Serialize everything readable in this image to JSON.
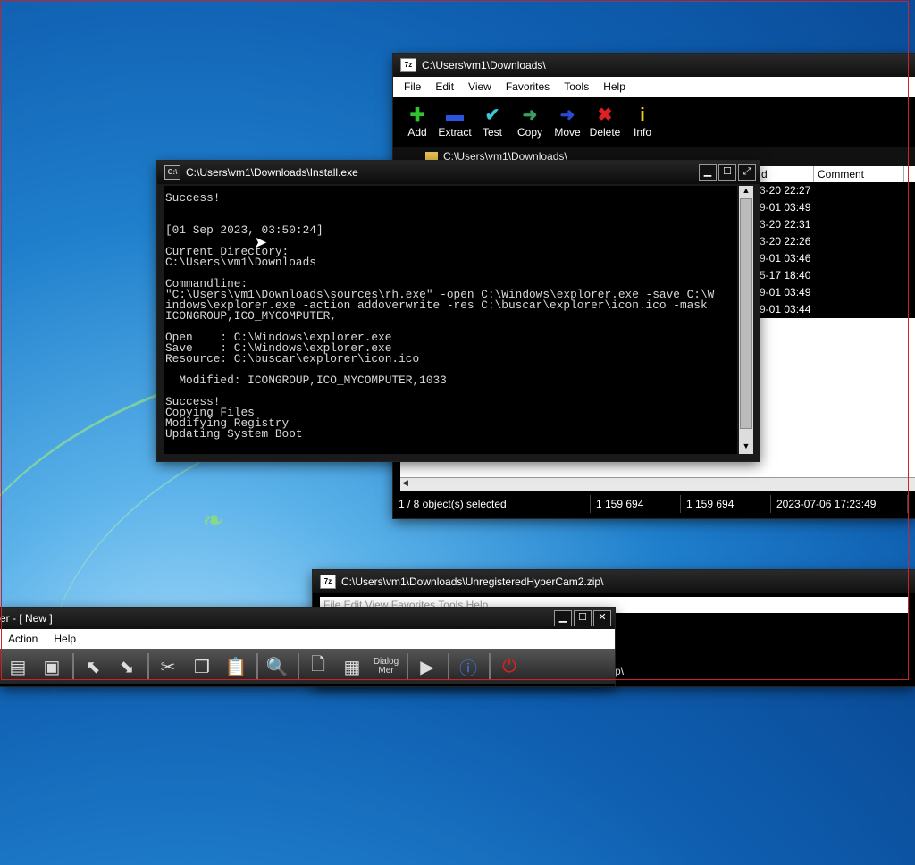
{
  "sevenzip": {
    "title": "C:\\Users\\vm1\\Downloads\\",
    "menu": [
      "File",
      "Edit",
      "View",
      "Favorites",
      "Tools",
      "Help"
    ],
    "toolbar": [
      {
        "label": "Add",
        "icon": "add-icon",
        "glyph": "✚",
        "color": "#2fc42f"
      },
      {
        "label": "Extract",
        "icon": "extract-icon",
        "glyph": "▬",
        "color": "#2a55e0"
      },
      {
        "label": "Test",
        "icon": "test-icon",
        "glyph": "✔",
        "color": "#3cc8d8"
      },
      {
        "label": "Copy",
        "icon": "copy-icon",
        "glyph": "➜",
        "color": "#3aa060"
      },
      {
        "label": "Move",
        "icon": "move-icon",
        "glyph": "➜",
        "color": "#2a4ad0"
      },
      {
        "label": "Delete",
        "icon": "delete-icon",
        "glyph": "✖",
        "color": "#e02020"
      },
      {
        "label": "Info",
        "icon": "info-icon",
        "glyph": "i",
        "color": "#e8d020"
      }
    ],
    "address": "C:\\Users\\vm1\\Downloads\\",
    "columns": [
      "d",
      "Comment"
    ],
    "rows": [
      "3-20 22:27",
      "9-01 03:49",
      "3-20 22:31",
      "3-20 22:26",
      "9-01 03:46",
      "5-17 18:40",
      "9-01 03:49",
      "9-01 03:44"
    ],
    "status": {
      "selection": "1 / 8 object(s) selected",
      "size": "1 159 694",
      "packed": "1 159 694",
      "modified": "2023-07-06 17:23:49"
    }
  },
  "console": {
    "title": "C:\\Users\\vm1\\Downloads\\Install.exe",
    "text": "Success!\n\n\n[01 Sep 2023, 03:50:24]\n\nCurrent Directory:\nC:\\Users\\vm1\\Downloads\n\nCommandline:\n\"C:\\Users\\vm1\\Downloads\\sources\\rh.exe\" -open C:\\Windows\\explorer.exe -save C:\\W\nindows\\explorer.exe -action addoverwrite -res C:\\buscar\\explorer\\icon.ico -mask\nICONGROUP,ICO_MYCOMPUTER,\n\nOpen    : C:\\Windows\\explorer.exe\nSave    : C:\\Windows\\explorer.exe\nResource: C:\\buscar\\explorer\\icon.ico\n\n  Modified: ICONGROUP,ICO_MYCOMPUTER,1033\n\nSuccess!\nCopying Files\nModifying Registry\nUpdating System Boot"
  },
  "sevenzip2": {
    "title": "C:\\Users\\vm1\\Downloads\\UnregisteredHyperCam2.zip\\",
    "menu_partial": "File  Edit  View  Favorites  Tools  Help",
    "address_tail": "p\\"
  },
  "resource_app": {
    "title": "er - [ New ]",
    "menu": [
      "Action",
      "Help"
    ],
    "dialog_label": "Dialog Mer"
  }
}
